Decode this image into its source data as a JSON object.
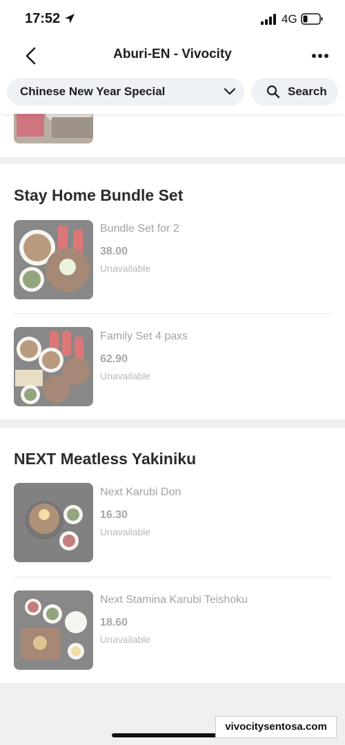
{
  "status_bar": {
    "time": "17:52",
    "network": "4G"
  },
  "nav": {
    "title": "Aburi-EN - Vivocity"
  },
  "filters": {
    "category": "Chinese New Year Special",
    "search_label": "Search"
  },
  "sections": [
    {
      "title": "Stay Home Bundle Set",
      "items": [
        {
          "name": "Bundle Set for 2",
          "price": "38.00",
          "status": "Unavailable"
        },
        {
          "name": "Family Set 4 paxs",
          "price": "62.90",
          "status": "Unavailable"
        }
      ]
    },
    {
      "title": "NEXT Meatless Yakiniku",
      "items": [
        {
          "name": "Next Karubi Don",
          "price": "16.30",
          "status": "Unavailable"
        },
        {
          "name": "Next Stamina Karubi Teishoku",
          "price": "18.60",
          "status": "Unavailable"
        }
      ]
    }
  ],
  "watermark": "vivocitysentosa.com"
}
